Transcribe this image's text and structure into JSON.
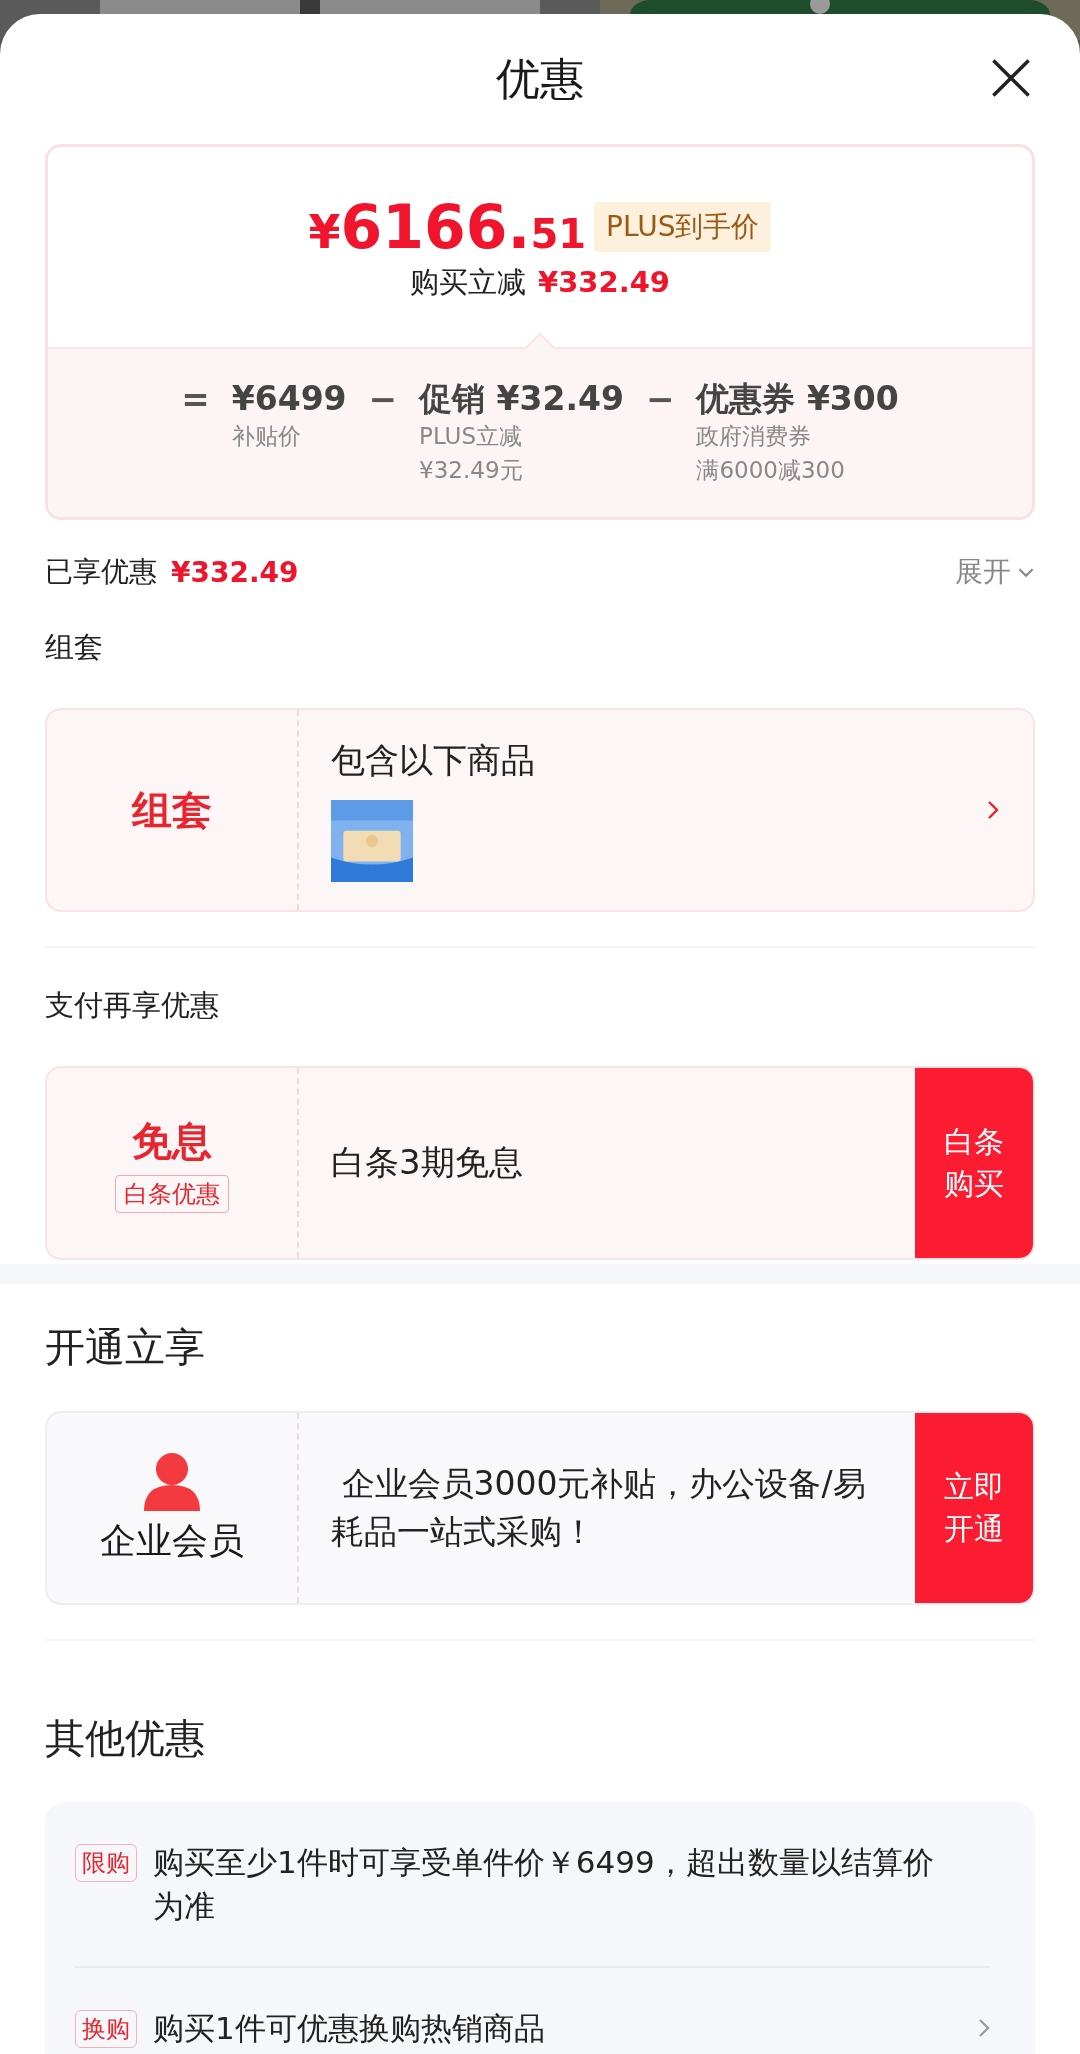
{
  "header": {
    "title": "优惠"
  },
  "price_card": {
    "currency": "¥",
    "integer": "6166.",
    "decimal": "51",
    "tag": "PLUS到手价",
    "reduction_label": "购买立减",
    "reduction_value": "¥332.49",
    "breakdown": [
      {
        "operator": "=",
        "title": "¥6499",
        "notes": [
          "补贴价"
        ]
      },
      {
        "operator": "−",
        "title": "促销 ¥32.49",
        "notes": [
          "PLUS立减",
          "¥32.49元"
        ]
      },
      {
        "operator": "−",
        "title": "优惠券 ¥300",
        "notes": [
          "政府消费券",
          "满6000减300"
        ]
      }
    ]
  },
  "enjoyed": {
    "label": "已享优惠",
    "value": "¥332.49",
    "toggle": "展开"
  },
  "sections": [
    {
      "heading": "组套",
      "card": {
        "kind": "bundle",
        "left_title": "组套",
        "title": "包含以下商品"
      }
    },
    {
      "heading": "支付再享优惠",
      "card": {
        "kind": "payment",
        "left_title": "免息",
        "left_tag": "白条优惠",
        "title": "白条3期免息",
        "action": [
          "白条",
          "购买"
        ]
      }
    },
    {
      "heading": "开通立享",
      "card": {
        "kind": "member",
        "left_title": "企业会员",
        "title": " 企业会员3000元补贴，办公设备/易耗品一站式采购！",
        "action": [
          "立即",
          "开通"
        ]
      }
    }
  ],
  "other": {
    "heading": "其他优惠",
    "items": [
      {
        "kind": "note",
        "tag": "限购",
        "text": "购买至少1件时可享受单件价￥6499，超出数量以结算价为准"
      },
      {
        "kind": "link",
        "tag": "换购",
        "text": "购买1件可优惠换购热销商品"
      }
    ]
  }
}
